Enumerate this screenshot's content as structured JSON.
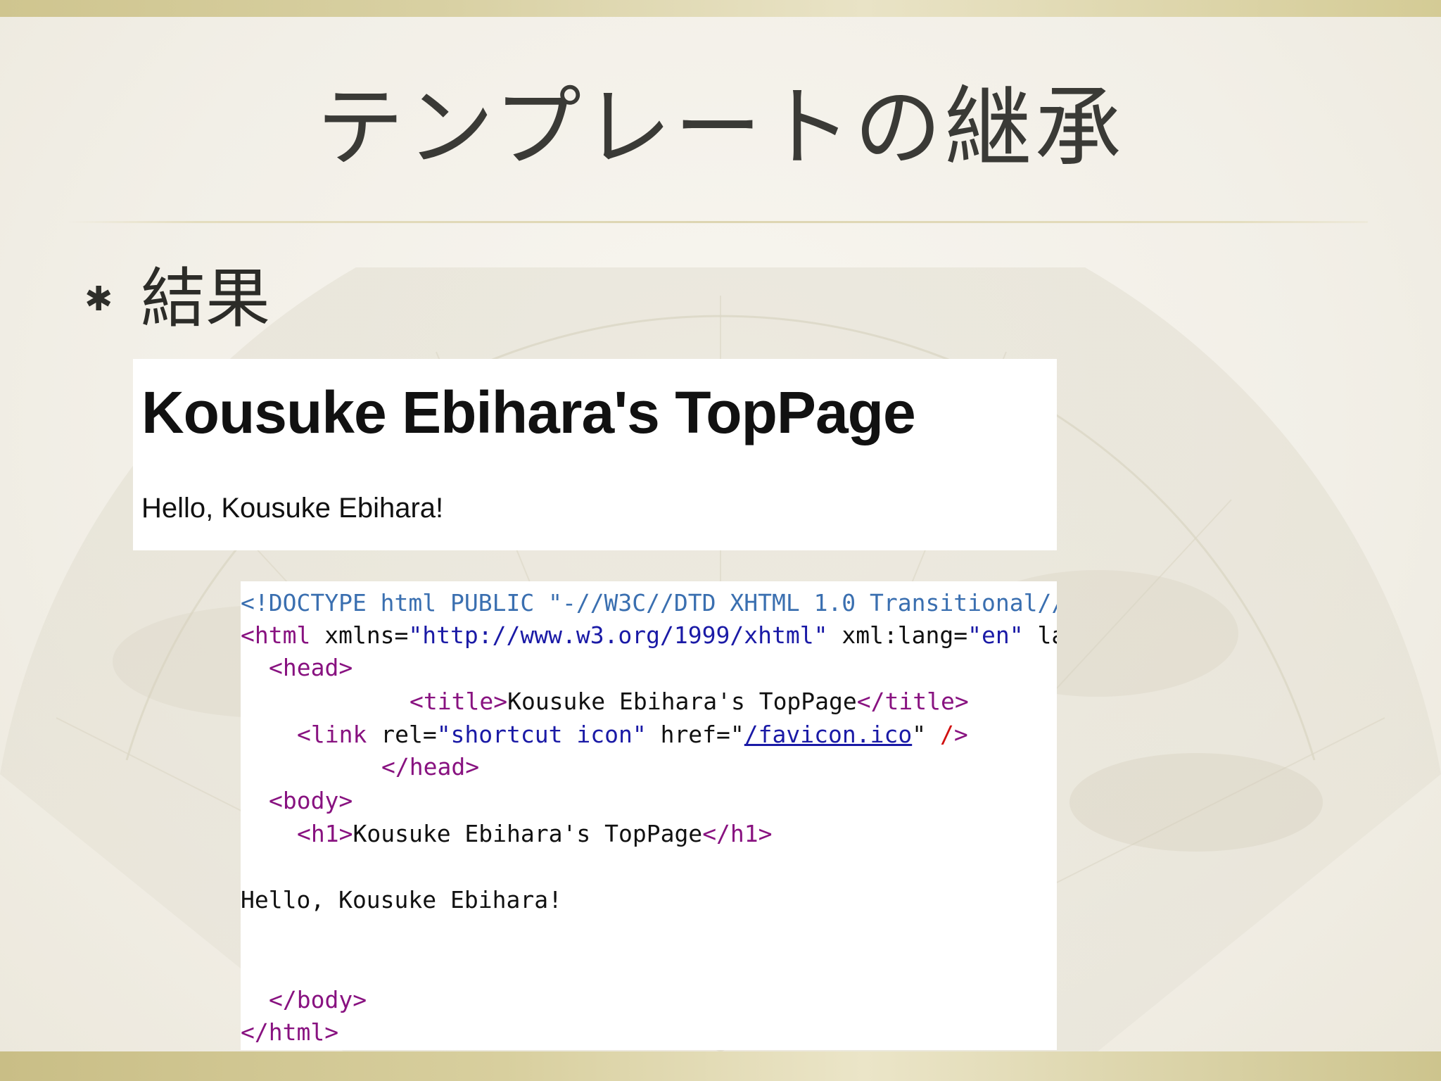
{
  "slide": {
    "title": "テンプレートの継承",
    "bullet_text": "結果",
    "bullet_icon": "asterisk-bullet-icon"
  },
  "browser_shot": {
    "heading": "Kousuke Ebihara's TopPage",
    "paragraph": "Hello, Kousuke Ebihara!"
  },
  "source_shot": {
    "line1": "<!DOCTYPE html PUBLIC \"-//W3C//DTD XHTML 1.0 Transitional//",
    "line2_open": "<html",
    "line2_attr1": " xmlns=",
    "line2_val1": "\"http://www.w3.org/1999/xhtml\"",
    "line2_attr2": " xml:lang=",
    "line2_val2": "\"en\"",
    "line2_tail": " la",
    "line3": "<head>",
    "line4_open": "<title>",
    "line4_text": "Kousuke Ebihara's TopPage",
    "line4_close": "</title>",
    "line5_open": "<link",
    "line5_attr1": " rel=",
    "line5_val1": "\"shortcut icon\"",
    "line5_attr2": " href=\"",
    "line5_link": "/favicon.ico",
    "line5_quote": "\" ",
    "line5_slash": "/",
    "line5_end": ">",
    "line6": "</head>",
    "line7": "<body>",
    "line8_open": "<h1>",
    "line8_text": "Kousuke Ebihara's TopPage",
    "line8_close": "</h1>",
    "line9": "Hello, Kousuke Ebihara!",
    "line10": "</body>",
    "line11": "</html>"
  },
  "colors": {
    "band": "#d4cb95",
    "title_text": "#3a3a36",
    "tag": "#881280",
    "attr_value": "#1a1aa6",
    "doctype": "#3a6fb0"
  }
}
